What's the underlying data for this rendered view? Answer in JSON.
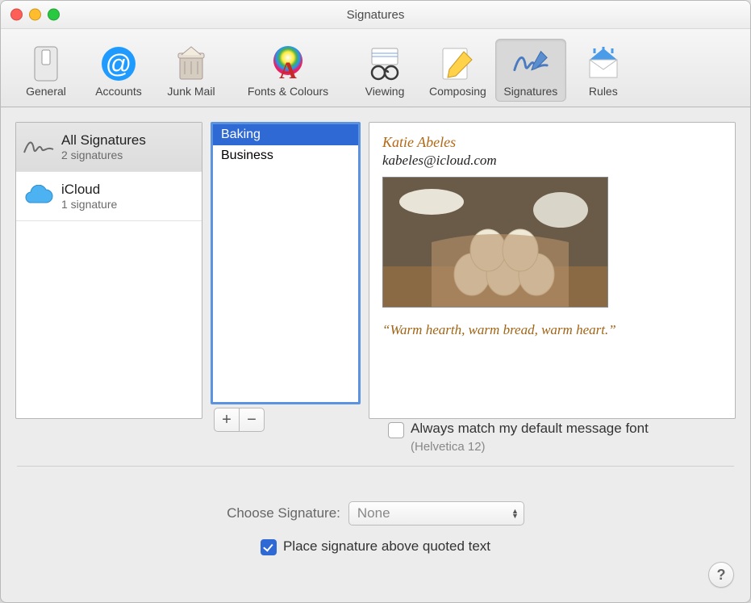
{
  "window_title": "Signatures",
  "toolbar": [
    {
      "label": "General"
    },
    {
      "label": "Accounts"
    },
    {
      "label": "Junk Mail"
    },
    {
      "label": "Fonts & Colours"
    },
    {
      "label": "Viewing"
    },
    {
      "label": "Composing"
    },
    {
      "label": "Signatures"
    },
    {
      "label": "Rules"
    }
  ],
  "accounts": [
    {
      "name": "All Signatures",
      "sub": "2 signatures"
    },
    {
      "name": "iCloud",
      "sub": "1 signature"
    }
  ],
  "signatures": [
    {
      "label": "Baking"
    },
    {
      "label": "Business"
    }
  ],
  "preview": {
    "name": "Katie Abeles",
    "email": "kabeles@icloud.com",
    "quote": "“Warm hearth, warm bread, warm heart.”"
  },
  "match_font_label": "Always match my default message font",
  "match_font_note": "(Helvetica 12)",
  "choose_label": "Choose Signature:",
  "choose_value": "None",
  "place_above_label": "Place signature above quoted text",
  "help": "?"
}
